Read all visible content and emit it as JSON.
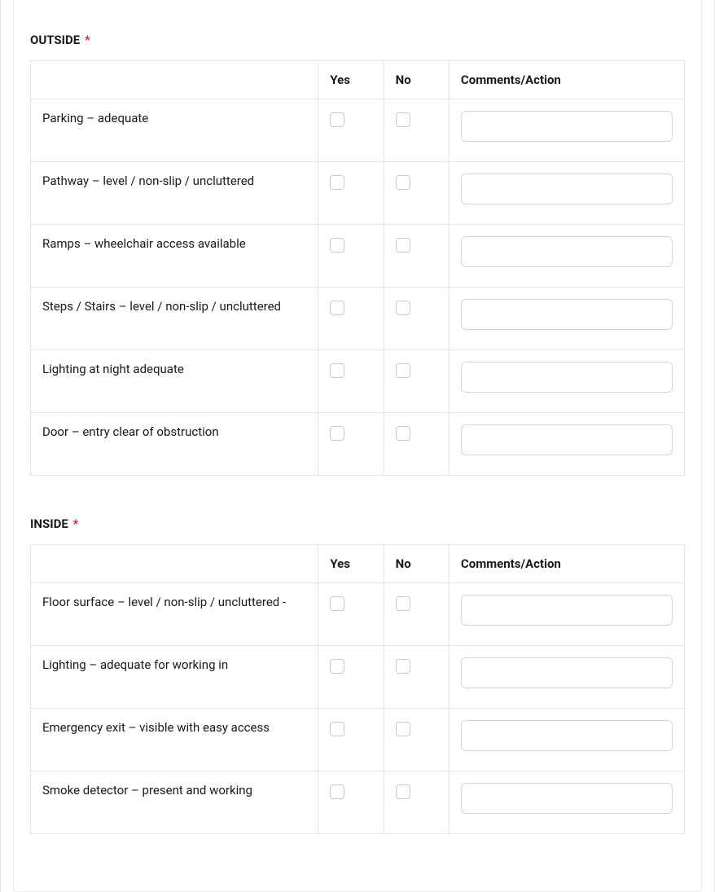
{
  "sections": [
    {
      "title": "OUTSIDE",
      "required": true,
      "headers": {
        "yes": "Yes",
        "no": "No",
        "comments": "Comments/Action"
      },
      "rows": [
        {
          "label": "Parking – adequate",
          "yes": false,
          "no": false,
          "comment": ""
        },
        {
          "label": "Pathway – level / non-slip / uncluttered",
          "yes": false,
          "no": false,
          "comment": ""
        },
        {
          "label": "Ramps – wheelchair access available",
          "yes": false,
          "no": false,
          "comment": ""
        },
        {
          "label": "Steps / Stairs – level / non-slip / uncluttered",
          "yes": false,
          "no": false,
          "comment": ""
        },
        {
          "label": "Lighting at night adequate",
          "yes": false,
          "no": false,
          "comment": ""
        },
        {
          "label": "Door – entry clear of obstruction",
          "yes": false,
          "no": false,
          "comment": ""
        }
      ]
    },
    {
      "title": "INSIDE",
      "required": true,
      "headers": {
        "yes": "Yes",
        "no": "No",
        "comments": "Comments/Action"
      },
      "rows": [
        {
          "label": "Floor surface – level / non-slip / uncluttered -",
          "yes": false,
          "no": false,
          "comment": ""
        },
        {
          "label": "Lighting – adequate for working in",
          "yes": false,
          "no": false,
          "comment": ""
        },
        {
          "label": "Emergency exit – visible with easy access",
          "yes": false,
          "no": false,
          "comment": ""
        },
        {
          "label": "Smoke detector – present and working",
          "yes": false,
          "no": false,
          "comment": ""
        }
      ]
    }
  ],
  "required_marker": "*"
}
